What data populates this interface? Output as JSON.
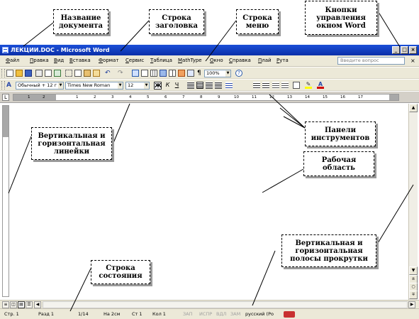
{
  "callouts": {
    "doc_name": "Название\nдокумента",
    "title_bar": "Строка\nзаголовка",
    "menu_bar": "Строка\nменю",
    "window_buttons": "Кнопки\nуправления\nокном Word",
    "rulers": "Вертикальная и\nгоризонтальная\nлинейки",
    "toolbars": "Панели\nинструментов",
    "work_area": "Рабочая\nобласть",
    "scrollbars": "Вертикальная и\nгоризонтальная\nполосы прокрутки",
    "status_bar": "Строка\nсостояния"
  },
  "window": {
    "title": "ЛЕКЦИИ.DOC - Microsoft Word",
    "minimize": "_",
    "restore": "□",
    "close": "×"
  },
  "menu": {
    "items": [
      "Файл",
      "Правка",
      "Вид",
      "Вставка",
      "Формат",
      "Сервис",
      "Таблица",
      "MathType",
      "Окно",
      "Справка",
      "Плай",
      "Рута"
    ],
    "help_placeholder": "Введите вопрос",
    "close": "×"
  },
  "toolbar_standard": {
    "zoom": "100%",
    "pilcrow": "¶"
  },
  "toolbar_formatting": {
    "style": "Обычный + 12 г",
    "font": "Times New Roman",
    "size": "12",
    "bold": "Ж",
    "italic": "К",
    "underline": "Ч"
  },
  "ruler": {
    "numbers": [
      "1",
      "2",
      "1",
      "1",
      "2",
      "3",
      "4",
      "5",
      "6",
      "7",
      "8",
      "9",
      "10",
      "11",
      "12",
      "13",
      "14",
      "15",
      "16",
      "17"
    ],
    "corner": "L"
  },
  "status": {
    "page": "Стр. 1",
    "section": "Разд 1",
    "pages": "1/14",
    "at": "На 2см",
    "line": "Ст 1",
    "col": "Кол 1",
    "rec": "ЗАП",
    "trk": "ИСПР",
    "ext": "ВДЛ",
    "ovr": "ЗАМ",
    "lang": "русский (Ро"
  },
  "colors": {
    "title_bar": "#1b4fd8",
    "chrome": "#ece9d8"
  }
}
